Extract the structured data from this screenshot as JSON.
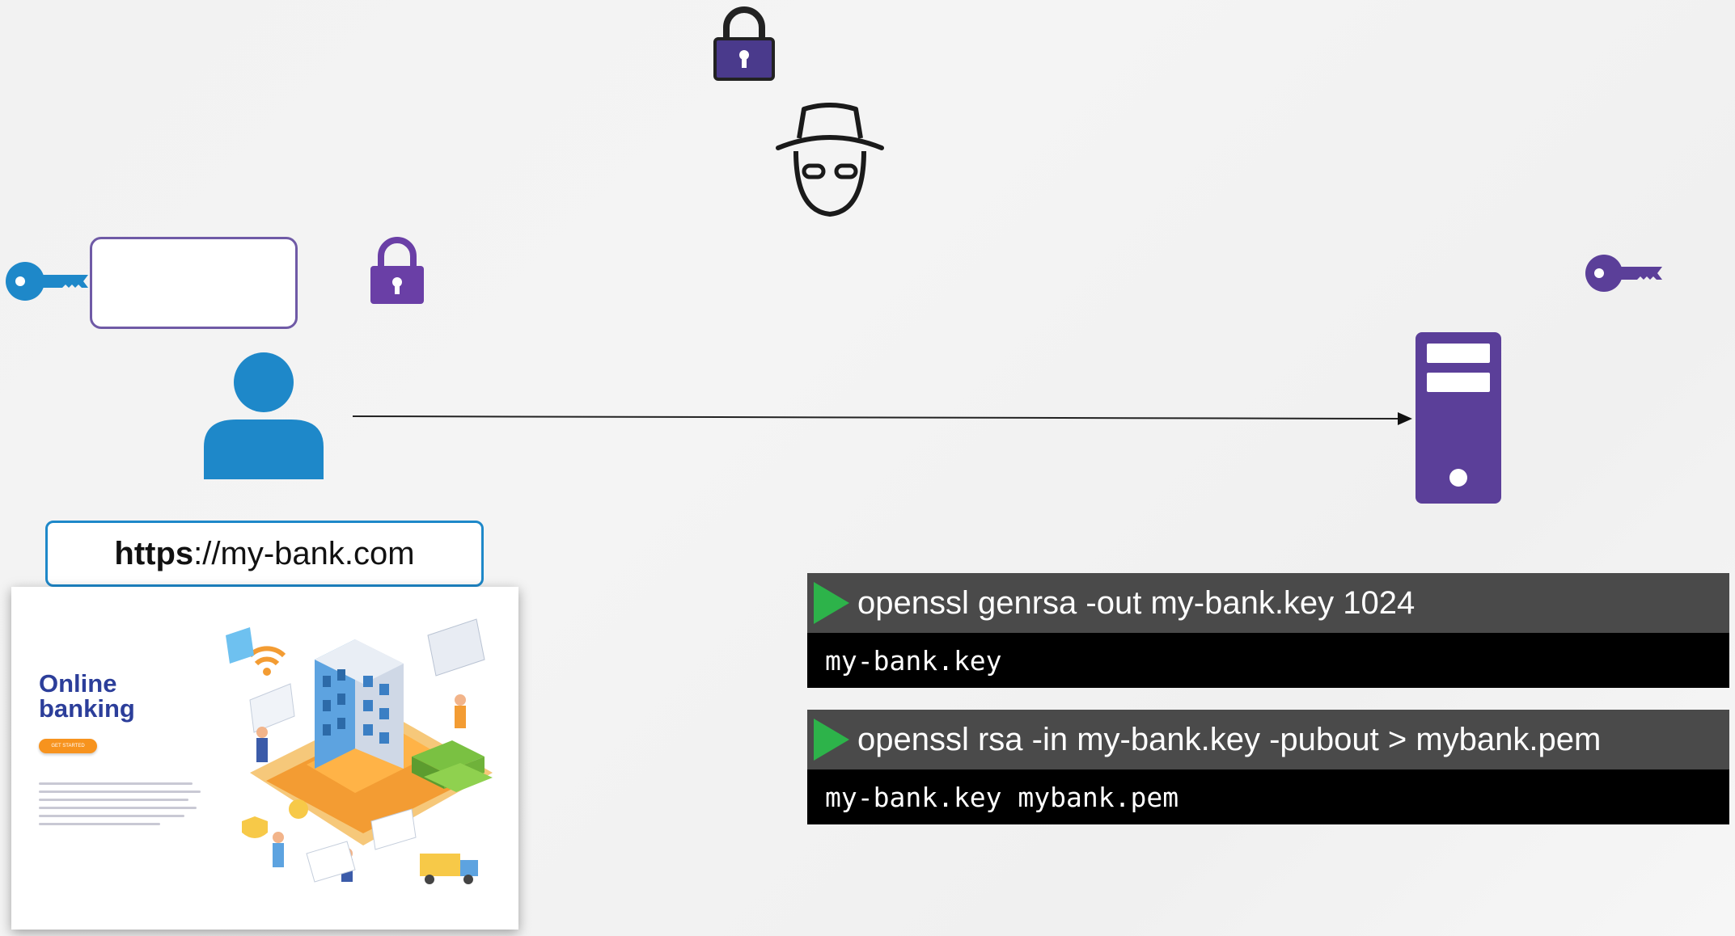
{
  "url_bar": {
    "scheme": "https",
    "rest": "://my-bank.com"
  },
  "website": {
    "title": "Online banking",
    "cta": "GET STARTED"
  },
  "terminals": [
    {
      "command": "openssl genrsa -out my-bank.key 1024",
      "output": "my-bank.key"
    },
    {
      "command": "openssl rsa -in my-bank.key -pubout > mybank.pem",
      "output": "my-bank.key mybank.pem"
    }
  ],
  "icons": {
    "top_lock": "padlock-icon",
    "hacker": "hacker-icon",
    "client_key": "key-icon",
    "client_lock": "padlock-icon",
    "user": "user-icon",
    "server": "server-icon",
    "server_key": "key-icon",
    "play": "play-icon"
  },
  "colors": {
    "purple": "#5b3f99",
    "blue": "#1e88c9",
    "terminal_header": "#4a4a4a",
    "terminal_body": "#000000",
    "play_green": "#2db34a"
  }
}
